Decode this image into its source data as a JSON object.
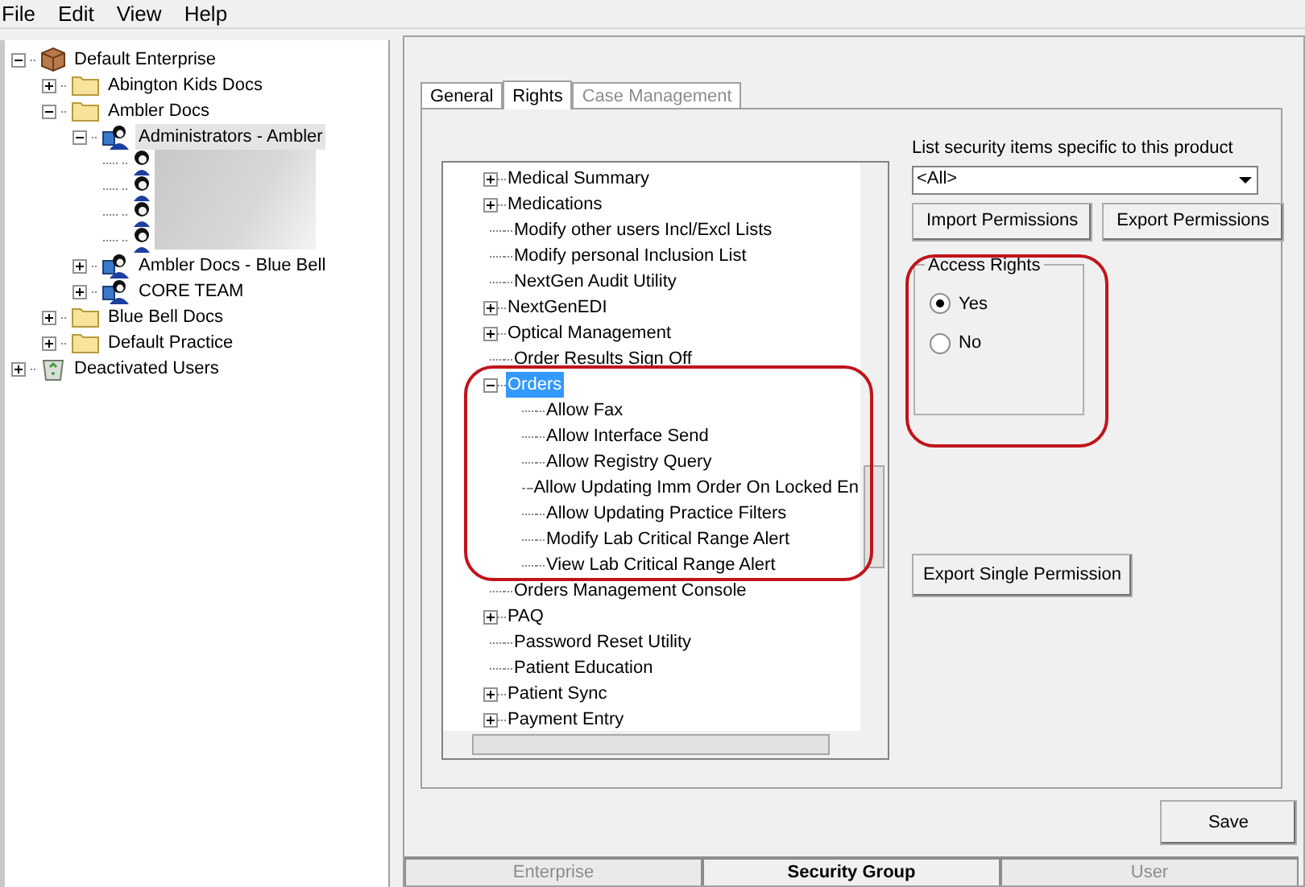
{
  "menu": [
    "File",
    "Edit",
    "View",
    "Help"
  ],
  "left_tree": [
    {
      "kind": "enterprise",
      "label": "Default Enterprise",
      "expanded": true,
      "children": [
        {
          "kind": "folder",
          "label": "Abington Kids Docs",
          "expanded": false
        },
        {
          "kind": "folder",
          "label": "Ambler Docs",
          "expanded": true,
          "children": [
            {
              "kind": "group",
              "label": "Administrators - Ambler",
              "expanded": true,
              "selected": true,
              "children": [
                {
                  "kind": "user"
                },
                {
                  "kind": "user"
                },
                {
                  "kind": "user"
                },
                {
                  "kind": "user"
                }
              ]
            },
            {
              "kind": "group",
              "label": "Ambler Docs - Blue Bell",
              "expanded": false,
              "selected": false
            },
            {
              "kind": "group",
              "label": "CORE TEAM",
              "expanded": false,
              "selected": false
            }
          ]
        },
        {
          "kind": "folder",
          "label": "Blue Bell Docs",
          "expanded": false
        },
        {
          "kind": "folder",
          "label": "Default Practice",
          "expanded": false
        }
      ]
    },
    {
      "kind": "trash",
      "label": "Deactivated Users",
      "expanded": false
    }
  ],
  "tabs": [
    {
      "label": "General",
      "selected": false,
      "disabled": false
    },
    {
      "label": "Rights",
      "selected": true,
      "disabled": false
    },
    {
      "label": "Case Management",
      "selected": false,
      "disabled": true
    }
  ],
  "rights_tree": [
    {
      "label": "Medical Summary",
      "expanded": false,
      "selected": false
    },
    {
      "label": "Medications",
      "expanded": false,
      "selected": false
    },
    {
      "label": "Modify other users Incl/Excl Lists",
      "selected": false
    },
    {
      "label": "Modify personal Inclusion List",
      "selected": false
    },
    {
      "label": "NextGen Audit Utility",
      "selected": false
    },
    {
      "label": "NextGenEDI",
      "expanded": false,
      "selected": false
    },
    {
      "label": "Optical Management",
      "expanded": false,
      "selected": false
    },
    {
      "label": "Order Results Sign Off",
      "selected": false
    },
    {
      "label": "Orders",
      "expanded": true,
      "selected": true,
      "children": [
        {
          "label": "Allow Fax",
          "selected": false
        },
        {
          "label": "Allow Interface Send",
          "selected": false
        },
        {
          "label": "Allow Registry Query",
          "selected": false
        },
        {
          "label": "Allow Updating Imm Order On Locked En",
          "selected": false
        },
        {
          "label": "Allow Updating Practice Filters",
          "selected": false
        },
        {
          "label": "Modify Lab Critical Range Alert",
          "selected": false
        },
        {
          "label": "View Lab Critical Range Alert",
          "selected": false
        }
      ]
    },
    {
      "label": "Orders Management Console",
      "selected": false
    },
    {
      "label": "PAQ",
      "expanded": false,
      "selected": false
    },
    {
      "label": "Password Reset Utility",
      "selected": false
    },
    {
      "label": "Patient Education",
      "selected": false
    },
    {
      "label": "Patient Sync",
      "expanded": false,
      "selected": false
    },
    {
      "label": "Payment Entry",
      "expanded": false,
      "selected": false
    }
  ],
  "product_filter": {
    "label": "List security items specific to this product",
    "value": "<All>"
  },
  "buttons": {
    "import": "Import Permissions",
    "export": "Export Permissions",
    "export_single": "Export Single Permission",
    "save": "Save"
  },
  "access_rights": {
    "title": "Access Rights",
    "options": [
      {
        "label": "Yes",
        "selected": true
      },
      {
        "label": "No",
        "selected": false
      }
    ]
  },
  "bottom_tabs": [
    {
      "label": "Enterprise",
      "selected": false
    },
    {
      "label": "Security Group",
      "selected": true
    },
    {
      "label": "User",
      "selected": false
    }
  ]
}
